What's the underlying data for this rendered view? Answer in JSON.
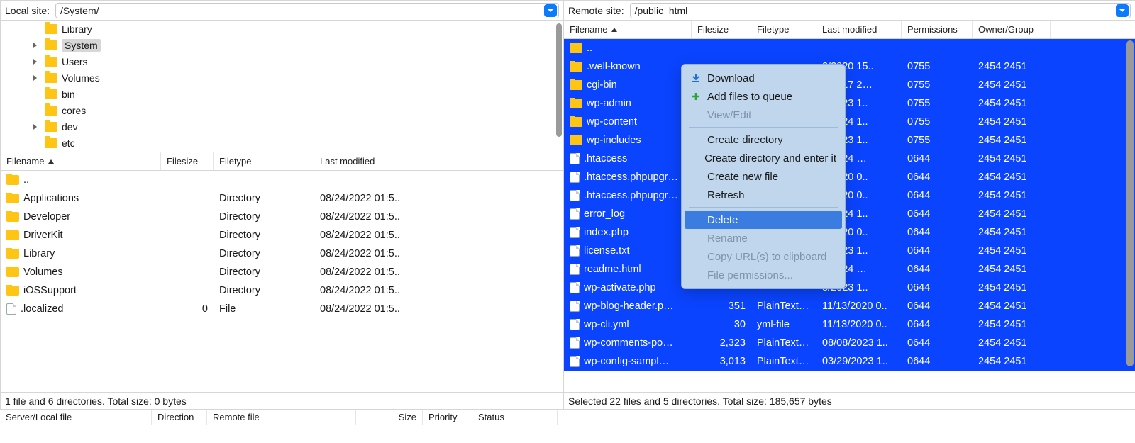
{
  "left": {
    "site_label": "Local site:",
    "site_path": "/System/",
    "tree": [
      {
        "indent": 2,
        "disclosure": "none",
        "label": "Library",
        "selected": false
      },
      {
        "indent": 2,
        "disclosure": "right",
        "label": "System",
        "selected": true
      },
      {
        "indent": 2,
        "disclosure": "right",
        "label": "Users",
        "selected": false
      },
      {
        "indent": 2,
        "disclosure": "right",
        "label": "Volumes",
        "selected": false
      },
      {
        "indent": 2,
        "disclosure": "none",
        "label": "bin",
        "selected": false
      },
      {
        "indent": 2,
        "disclosure": "none",
        "label": "cores",
        "selected": false
      },
      {
        "indent": 2,
        "disclosure": "right",
        "label": "dev",
        "selected": false
      },
      {
        "indent": 2,
        "disclosure": "none",
        "label": "etc",
        "selected": false
      }
    ],
    "headers": {
      "c0": "Filename",
      "c1": "Filesize",
      "c2": "Filetype",
      "c3": "Last modified"
    },
    "rows": [
      {
        "icon": "folder",
        "name": "..",
        "size": "",
        "type": "",
        "mod": ""
      },
      {
        "icon": "folder",
        "name": "Applications",
        "size": "",
        "type": "Directory",
        "mod": "08/24/2022 01:5.."
      },
      {
        "icon": "folder",
        "name": "Developer",
        "size": "",
        "type": "Directory",
        "mod": "08/24/2022 01:5.."
      },
      {
        "icon": "folder",
        "name": "DriverKit",
        "size": "",
        "type": "Directory",
        "mod": "08/24/2022 01:5.."
      },
      {
        "icon": "folder",
        "name": "Library",
        "size": "",
        "type": "Directory",
        "mod": "08/24/2022 01:5.."
      },
      {
        "icon": "folder",
        "name": "Volumes",
        "size": "",
        "type": "Directory",
        "mod": "08/24/2022 01:5.."
      },
      {
        "icon": "folder",
        "name": "iOSSupport",
        "size": "",
        "type": "Directory",
        "mod": "08/24/2022 01:5.."
      },
      {
        "icon": "file",
        "name": ".localized",
        "size": "0",
        "type": "File",
        "mod": "08/24/2022 01:5.."
      }
    ],
    "status": "1 file and 6 directories. Total size: 0 bytes"
  },
  "right": {
    "site_label": "Remote site:",
    "site_path": "/public_html",
    "headers": {
      "c0": "Filename",
      "c1": "Filesize",
      "c2": "Filetype",
      "c3": "Last modified",
      "c4": "Permissions",
      "c5": "Owner/Group"
    },
    "rows": [
      {
        "icon": "folder",
        "name": "..",
        "size": "",
        "type": "",
        "mod": "",
        "perm": "",
        "own": "",
        "sel": true
      },
      {
        "icon": "folder",
        "name": ".well-known",
        "size": "",
        "type": "",
        "mod": "2/2020 15..",
        "perm": "0755",
        "own": "2454 2451",
        "sel": true
      },
      {
        "icon": "folder",
        "name": "cgi-bin",
        "size": "",
        "type": "",
        "mod": "2/2017 2…",
        "perm": "0755",
        "own": "2454 2451",
        "sel": true
      },
      {
        "icon": "folder",
        "name": "wp-admin",
        "size": "",
        "type": "",
        "mod": "8/2023 1..",
        "perm": "0755",
        "own": "2454 2451",
        "sel": true
      },
      {
        "icon": "folder",
        "name": "wp-content",
        "size": "",
        "type": "",
        "mod": "9/2024 1..",
        "perm": "0755",
        "own": "2454 2451",
        "sel": true
      },
      {
        "icon": "folder",
        "name": "wp-includes",
        "size": "",
        "type": "",
        "mod": "7/2023 1..",
        "perm": "0755",
        "own": "2454 2451",
        "sel": true
      },
      {
        "icon": "file",
        "name": ".htaccess",
        "size": "",
        "type": "",
        "mod": "8/2024 …",
        "perm": "0644",
        "own": "2454 2451",
        "sel": true
      },
      {
        "icon": "file",
        "name": ".htaccess.phpupgr…",
        "size": "",
        "type": "",
        "mod": "7/2020 0..",
        "perm": "0644",
        "own": "2454 2451",
        "sel": true
      },
      {
        "icon": "file",
        "name": ".htaccess.phpupgr…",
        "size": "",
        "type": "",
        "mod": "7/2020 0..",
        "perm": "0644",
        "own": "2454 2451",
        "sel": true
      },
      {
        "icon": "file",
        "name": "error_log",
        "size": "",
        "type": "",
        "mod": "7/2024 1..",
        "perm": "0644",
        "own": "2454 2451",
        "sel": true
      },
      {
        "icon": "file",
        "name": "index.php",
        "size": "",
        "type": "",
        "mod": "3/2020 0..",
        "perm": "0644",
        "own": "2454 2451",
        "sel": true
      },
      {
        "icon": "file",
        "name": "license.txt",
        "size": "",
        "type": "",
        "mod": "7/2023 1..",
        "perm": "0644",
        "own": "2454 2451",
        "sel": true
      },
      {
        "icon": "file",
        "name": "readme.html",
        "size": "",
        "type": "",
        "mod": "0/2024 …",
        "perm": "0644",
        "own": "2454 2451",
        "sel": true
      },
      {
        "icon": "file",
        "name": "wp-activate.php",
        "size": "",
        "type": "",
        "mod": "8/2023 1..",
        "perm": "0644",
        "own": "2454 2451",
        "sel": true
      },
      {
        "icon": "file",
        "name": "wp-blog-header.p…",
        "size": "351",
        "type": "PlainTextT…",
        "mod": "11/13/2020 0..",
        "perm": "0644",
        "own": "2454 2451",
        "sel": true
      },
      {
        "icon": "file",
        "name": "wp-cli.yml",
        "size": "30",
        "type": "yml-file",
        "mod": "11/13/2020 0..",
        "perm": "0644",
        "own": "2454 2451",
        "sel": true
      },
      {
        "icon": "file",
        "name": "wp-comments-po…",
        "size": "2,323",
        "type": "PlainTextT…",
        "mod": "08/08/2023 1..",
        "perm": "0644",
        "own": "2454 2451",
        "sel": true
      },
      {
        "icon": "file",
        "name": "wp-config-sampl…",
        "size": "3,013",
        "type": "PlainTextT…",
        "mod": "03/29/2023 1..",
        "perm": "0644",
        "own": "2454 2451",
        "sel": true
      }
    ],
    "status": "Selected 22 files and 5 directories. Total size: 185,657 bytes"
  },
  "context_menu": [
    {
      "icon": "download",
      "label": "Download",
      "disabled": false
    },
    {
      "icon": "add",
      "label": "Add files to queue",
      "disabled": false
    },
    {
      "icon": "",
      "label": "View/Edit",
      "disabled": true
    },
    {
      "sep": true
    },
    {
      "icon": "",
      "label": "Create directory",
      "disabled": false
    },
    {
      "icon": "",
      "label": "Create directory and enter it",
      "disabled": false
    },
    {
      "icon": "",
      "label": "Create new file",
      "disabled": false
    },
    {
      "icon": "",
      "label": "Refresh",
      "disabled": false
    },
    {
      "sep": true
    },
    {
      "icon": "",
      "label": "Delete",
      "disabled": false,
      "highlight": true
    },
    {
      "icon": "",
      "label": "Rename",
      "disabled": true
    },
    {
      "icon": "",
      "label": "Copy URL(s) to clipboard",
      "disabled": true
    },
    {
      "icon": "",
      "label": "File permissions...",
      "disabled": true
    }
  ],
  "queue_headers": {
    "c0": "Server/Local file",
    "c1": "Direction",
    "c2": "Remote file",
    "c3": "Size",
    "c4": "Priority",
    "c5": "Status"
  }
}
